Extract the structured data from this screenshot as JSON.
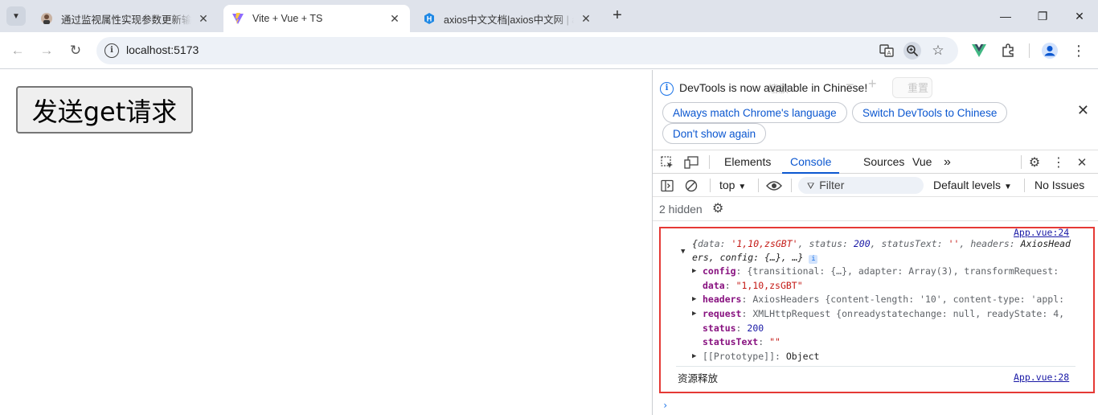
{
  "browser": {
    "tabs": [
      {
        "title": "通过监视属性实现参数更新输出",
        "favicon": "avatar-icon",
        "active": false
      },
      {
        "title": "Vite + Vue + TS",
        "favicon": "vite-icon",
        "active": true
      },
      {
        "title": "axios中文文档|axios中文网 | ax",
        "favicon": "h-icon",
        "active": false
      }
    ],
    "new_tab_glyph": "+",
    "url": "localhost:5173"
  },
  "page": {
    "button_label": "发送get请求"
  },
  "devtools": {
    "infobar": {
      "message": "DevTools is now available in Chinese!",
      "ghost_left": "缩放",
      "ghost_right": "重置",
      "buttons": [
        "Always match Chrome's language",
        "Switch DevTools to Chinese",
        "Don't show again"
      ]
    },
    "tabs": [
      "Elements",
      "Console",
      "Sources",
      "Vue"
    ],
    "active_tab": "Console",
    "more_tabs": "»",
    "console_bar": {
      "context": "top",
      "filter_placeholder": "Filter",
      "levels": "Default levels",
      "issues": "No Issues"
    },
    "hidden": "2 hidden",
    "output": {
      "link1": "App.vue:24",
      "summary_l1_prefix": "{",
      "summary_l1": [
        {
          "k": "data",
          "v": "'1,10,zsGBT'",
          "t": "str"
        },
        {
          "k": "status",
          "v": "200",
          "t": "num"
        },
        {
          "k": "statusText",
          "v": "''",
          "t": "str"
        },
        {
          "k": "headers",
          "v": "AxiosHead",
          "t": "obj"
        }
      ],
      "summary_l2": "ers, config: {…}, …}",
      "props": [
        {
          "key": "config",
          "expandable": true,
          "value": "{transitional: {…}, adapter: Array(3), transformRequest:"
        },
        {
          "key": "data",
          "expandable": false,
          "value": "\"1,10,zsGBT\""
        },
        {
          "key": "headers",
          "expandable": true,
          "value": "AxiosHeaders  {content-length: '10', content-type: 'appl:"
        },
        {
          "key": "request",
          "expandable": true,
          "value": "XMLHttpRequest  {onreadystatechange: null, readyState: 4,"
        },
        {
          "key": "status",
          "expandable": false,
          "value": "200"
        },
        {
          "key": "statusText",
          "expandable": false,
          "value": "\"\""
        },
        {
          "key": "[[Prototype]]",
          "expandable": true,
          "value": "Object"
        }
      ],
      "log2": "资源释放",
      "link2": "App.vue:28"
    }
  },
  "colors": {
    "highlight_border": "#e53935",
    "accent": "#0b57d0"
  }
}
